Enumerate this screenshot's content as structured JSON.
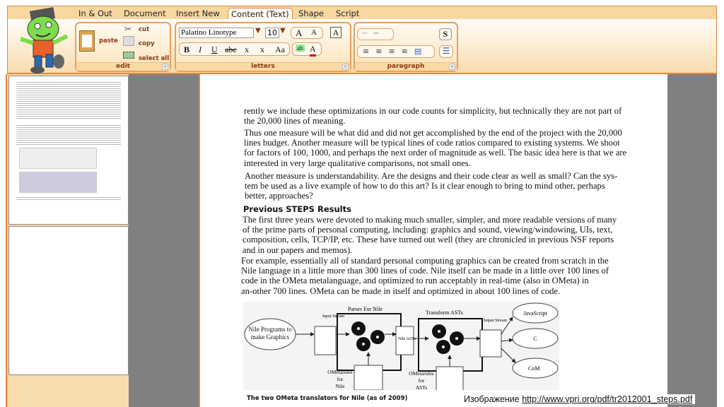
{
  "tabs": [
    "In & Out",
    "Document",
    "Insert New",
    "Content (Text)",
    "Shape",
    "Script"
  ],
  "active_tab": "Content (Text)",
  "edit": {
    "paste": "paste",
    "cut": "cut",
    "copy": "copy",
    "select_all": "select all",
    "label": "edit"
  },
  "letters": {
    "font": "Palatino Linotype",
    "size": "10",
    "bold": "B",
    "italic": "I",
    "underline": "U",
    "strike": "abc",
    "subscript": "x",
    "superscript": "x",
    "case": "Aa",
    "highlight": "ab",
    "color": "A",
    "grow": "A",
    "shrink": "A",
    "box": "A",
    "label": "letters"
  },
  "paragraph": {
    "style": "S",
    "label": "paragraph"
  },
  "document": {
    "p1": [
      "rently we include these optimizations in our code counts for simplicity, but technically they are not part of",
      "the 20,000 lines of meaning."
    ],
    "p2": [
      "Thus one measure will be what did and did not get accomplished by the end of the project with the 20,000",
      "lines budget. Another measure will be typical lines of code ratios compared to existing systems. We shoot",
      "for factors of 100, 1000, and perhaps the next order of magnitude as well. The basic idea here is that we are",
      "interested in very large qualitative comparisons, not small ones."
    ],
    "p3": [
      "Another measure is understandability. Are the designs and their code clear as well as small? Can the sys-",
      "tem be used as a live example of how to do this art? Is it clear enough to bring to mind other, perhaps",
      "better, approaches?"
    ],
    "heading": "Previous STEPS Results",
    "p4": [
      "The first three years were devoted to making much smaller, simpler, and more readable versions of many",
      "of the prime parts of personal computing, including: graphics and sound, viewing/windowing, UIs, text,",
      "composition, cells, TCP/IP, etc. These have turned out well (they are chronicled in previous NSF reports",
      "and in our papers and memos)."
    ],
    "p5": [
      "For example, essentially all of standard personal computing graphics can be created from scratch in the",
      "Nile language in a little more than 300 lines of code. Nile itself can be made in a little over 100 lines of",
      "code in the OMeta metalanguage, and optimized to run acceptably in real-time (also in OMeta) in",
      "an-other 700 lines. OMeta can be made in itself and optimized in about 100 lines of code."
    ],
    "diagram": {
      "source": "Nile Programs to make Graphics",
      "input": "Input Stream",
      "parser": "Parser For Nile",
      "nile_asts": "Nile ASTs",
      "transform": "Transform ASTs",
      "output": "Output Stream",
      "targets": [
        "JavaScript",
        "C",
        "CoM"
      ],
      "rules1": [
        "OMetarules",
        "for",
        "Nile"
      ],
      "rules2": [
        "OMetarules",
        "for",
        "ASTs"
      ]
    },
    "caption": "The two OMeta translators for Nile (as of 2009)"
  },
  "credit": {
    "prefix": "Изображение ",
    "url": "http://www.vpri.org/pdf/tr2012001_steps.pdf"
  },
  "colors": {
    "accent": "#e8843a",
    "toolbar": "#f8d8a0",
    "gray": "#808080"
  }
}
